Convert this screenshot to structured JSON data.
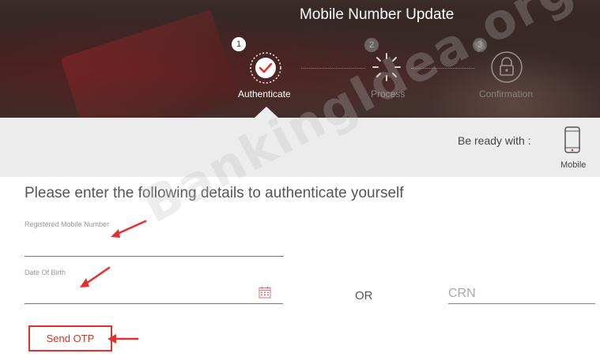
{
  "header": {
    "title": "Mobile Number Update",
    "steps": [
      {
        "number": "1",
        "label": "Authenticate",
        "icon": "check-circle-icon",
        "state": "active"
      },
      {
        "number": "2",
        "label": "Process",
        "icon": "spinner-icon",
        "state": "inactive"
      },
      {
        "number": "3",
        "label": "Confirmation",
        "icon": "lock-icon",
        "state": "inactive"
      }
    ]
  },
  "band": {
    "ready_text": "Be ready with :",
    "mobile_label": "Mobile",
    "mobile_icon": "mobile-phone-icon"
  },
  "form": {
    "heading": "Please enter the following details to authenticate yourself",
    "mobile_label": "Registered Mobile Number",
    "dob_label": "Date Of Birth",
    "or_text": "OR",
    "crn_placeholder": "CRN",
    "send_otp_label": "Send OTP",
    "calendar_icon": "calendar-icon"
  },
  "watermark": "BankingIdea.org",
  "colors": {
    "accent": "#e0312d",
    "band": "#ececec",
    "header_bg": "#2e2322"
  }
}
